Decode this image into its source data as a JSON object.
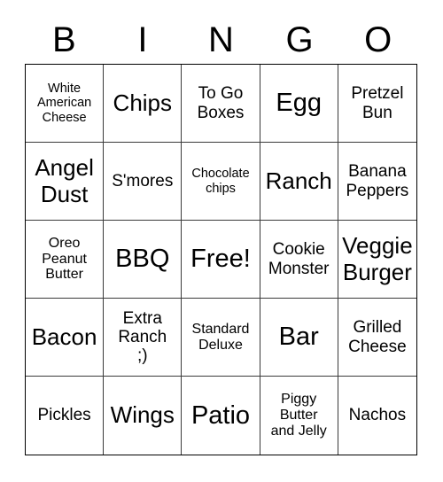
{
  "card": {
    "title": "BINGO",
    "header_letters": [
      "B",
      "I",
      "N",
      "G",
      "O"
    ],
    "free_space_label": "Free!",
    "colors": {
      "background": "#ffffff",
      "text": "#000000",
      "grid_line": "#3a3a3a",
      "outer_border": "#000000"
    },
    "grid": {
      "rows": 5,
      "columns": 5
    },
    "cells": [
      {
        "text": "White\nAmerican\nCheese",
        "size": "xs"
      },
      {
        "text": "Chips",
        "size": "lg"
      },
      {
        "text": "To Go\nBoxes",
        "size": "md"
      },
      {
        "text": "Egg",
        "size": "xl"
      },
      {
        "text": "Pretzel\nBun",
        "size": "md"
      },
      {
        "text": "Angel\nDust",
        "size": "lg"
      },
      {
        "text": "S'mores",
        "size": "md"
      },
      {
        "text": "Chocolate\nchips",
        "size": "xs"
      },
      {
        "text": "Ranch",
        "size": "lg"
      },
      {
        "text": "Banana\nPeppers",
        "size": "md"
      },
      {
        "text": "Oreo\nPeanut\nButter",
        "size": "sm"
      },
      {
        "text": "BBQ",
        "size": "xl"
      },
      {
        "text": "Free!",
        "size": "xl"
      },
      {
        "text": "Cookie\nMonster",
        "size": "md"
      },
      {
        "text": "Veggie\nBurger",
        "size": "lg"
      },
      {
        "text": "Bacon",
        "size": "lg"
      },
      {
        "text": "Extra\nRanch\n;)",
        "size": "md"
      },
      {
        "text": "Standard\nDeluxe",
        "size": "sm"
      },
      {
        "text": "Bar",
        "size": "xl"
      },
      {
        "text": "Grilled\nCheese",
        "size": "md"
      },
      {
        "text": "Pickles",
        "size": "md"
      },
      {
        "text": "Wings",
        "size": "lg"
      },
      {
        "text": "Patio",
        "size": "xl"
      },
      {
        "text": "Piggy\nButter\nand Jelly",
        "size": "sm"
      },
      {
        "text": "Nachos",
        "size": "md"
      }
    ]
  }
}
